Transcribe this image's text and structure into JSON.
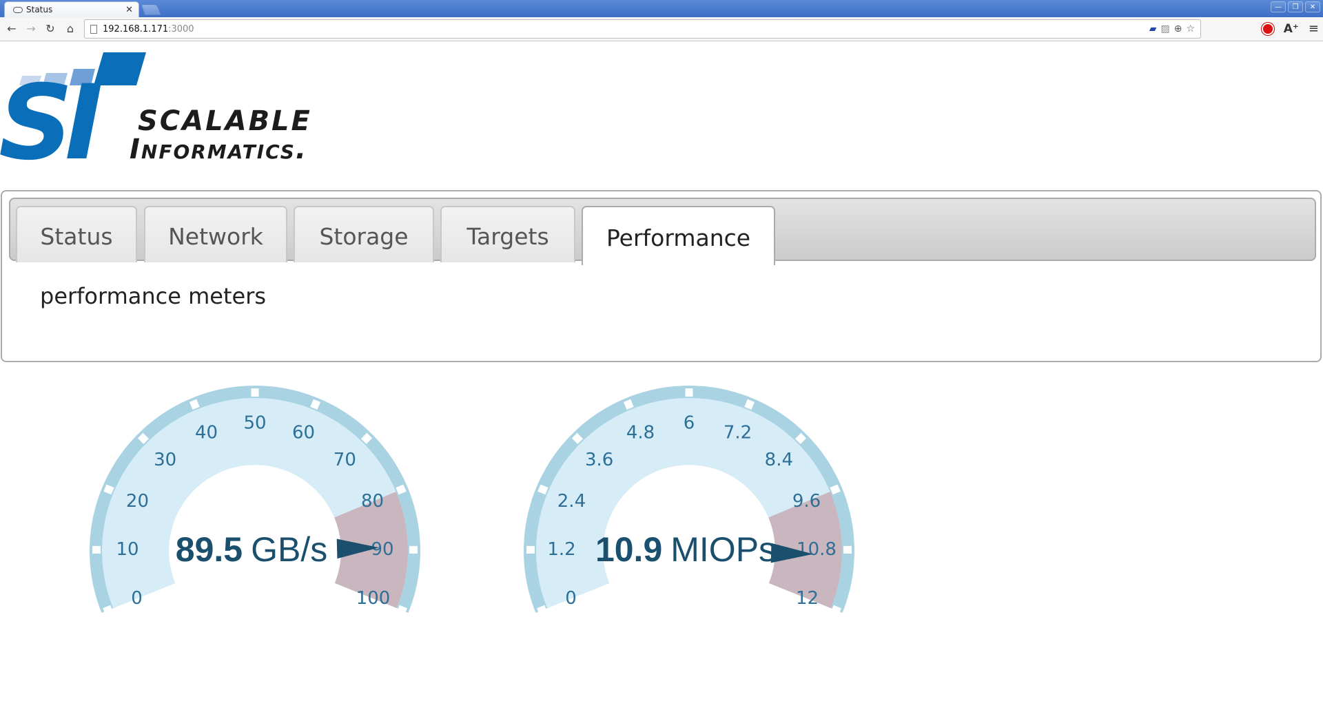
{
  "browser": {
    "tab_title": "Status",
    "url_host": "192.168.1.171",
    "url_port": ":3000",
    "icons": [
      "back-icon",
      "forward-icon",
      "reload-icon",
      "home-icon",
      "page-icon",
      "extension-icon",
      "flash-icon",
      "zoom-icon",
      "bookmark-star-icon",
      "adblock-icon",
      "font-size-icon",
      "menu-icon"
    ]
  },
  "logo": {
    "mark": "SI",
    "line1": "Scalable",
    "line2": "Informatics.",
    "brand_color": "#0a6fb8"
  },
  "tabs": [
    {
      "label": "Status",
      "active": false
    },
    {
      "label": "Network",
      "active": false
    },
    {
      "label": "Storage",
      "active": false
    },
    {
      "label": "Targets",
      "active": false
    },
    {
      "label": "Performance",
      "active": true
    }
  ],
  "panel": {
    "title": "performance meters"
  },
  "gauges": [
    {
      "value_text": "89.5",
      "unit": "GB/s",
      "value": 89.5,
      "min": 0,
      "max": 100,
      "ticks": [
        "0",
        "10",
        "20",
        "30",
        "40",
        "50",
        "60",
        "70",
        "80",
        "90",
        "100"
      ],
      "warn_from": 80,
      "warn_to": 100
    },
    {
      "value_text": "10.9",
      "unit": "MIOPs",
      "value": 10.9,
      "min": 0,
      "max": 12,
      "ticks": [
        "0",
        "1.2",
        "2.4",
        "3.6",
        "4.8",
        "6",
        "7.2",
        "8.4",
        "9.6",
        "10.8",
        "12"
      ],
      "warn_from": 9.6,
      "warn_to": 12
    }
  ],
  "colors": {
    "gauge_face": "#d6edf8",
    "gauge_rim": "#a9d3e3",
    "gauge_warn": "#c9b6bf",
    "needle": "#1b4f6e",
    "tick_label": "#2e6f96"
  }
}
